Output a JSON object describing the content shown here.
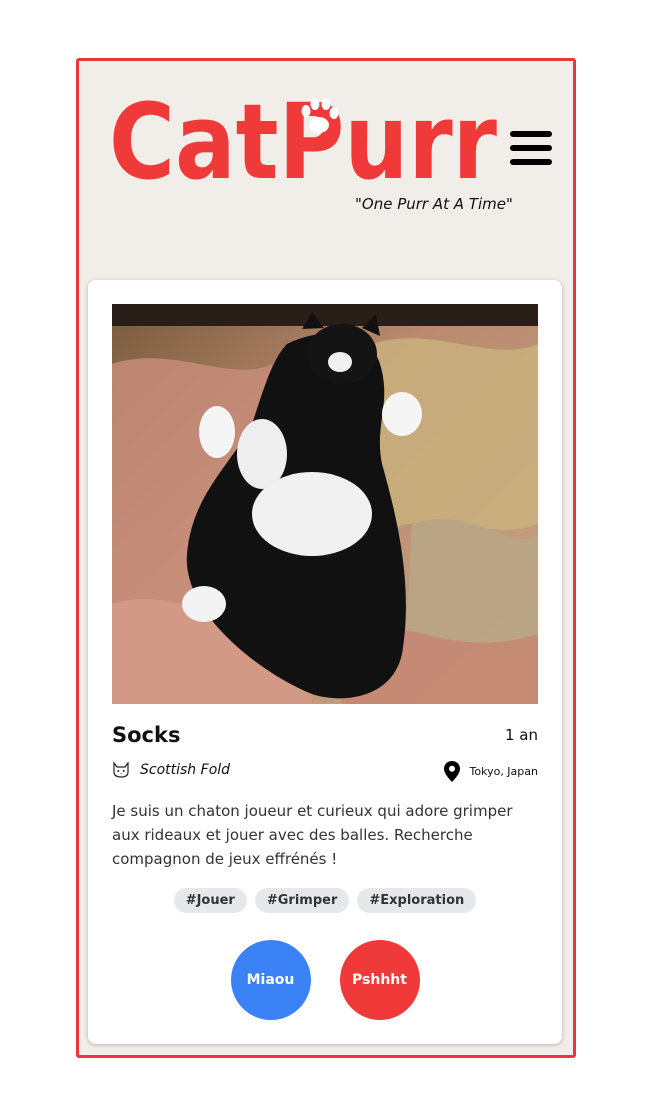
{
  "header": {
    "logo_text": "CatPurr",
    "tagline": "\"One Purr At A Time\""
  },
  "profile": {
    "name": "Socks",
    "age": "1 an",
    "breed": "Scottish Fold",
    "location": "Tokyo, Japan",
    "description": "Je suis un chaton joueur et curieux qui adore grimper aux rideaux et jouer avec des balles. Recherche compagnon de jeux effrénés !",
    "tags": [
      "#Jouer",
      "#Grimper",
      "#Exploration"
    ]
  },
  "actions": {
    "like_label": "Miaou",
    "dislike_label": "Pshhht"
  },
  "colors": {
    "brand_red": "#f03a3a",
    "like_blue": "#3b82f6",
    "frame_bg": "#f1eee9",
    "tag_bg": "#e6e8eb"
  },
  "icons": [
    "hamburger-menu-icon",
    "cat-face-icon",
    "map-pin-icon",
    "paw-icon"
  ]
}
